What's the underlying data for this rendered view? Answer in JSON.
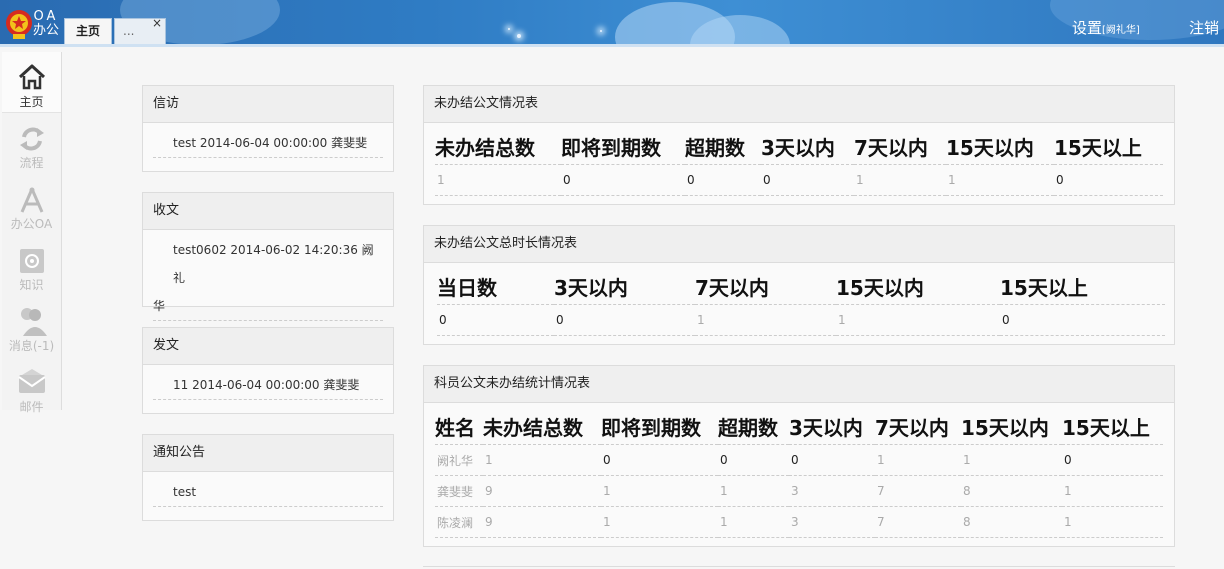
{
  "header": {
    "logo_text_1": "OA",
    "logo_text_2": "办公",
    "tabs": [
      {
        "label": "主页"
      },
      {
        "label": "...",
        "close": "×"
      }
    ],
    "settings_label": "设置",
    "settings_user": "[阙礼华]",
    "logout_label": "注销"
  },
  "nav": {
    "items": [
      {
        "label": "主页",
        "icon": "home-icon"
      },
      {
        "label": "流程",
        "icon": "flow-icon"
      },
      {
        "label": "办公OA",
        "icon": "compass-icon"
      },
      {
        "label": "知识",
        "icon": "knowledge-icon"
      },
      {
        "label": "消息(-1)",
        "icon": "message-icon"
      },
      {
        "label": "邮件",
        "icon": "mail-icon"
      }
    ]
  },
  "left_panels": {
    "xinfang": {
      "title": "信访",
      "items": [
        "test 2014-06-04 00:00:00 龚斐斐"
      ]
    },
    "shouwen": {
      "title": "收文",
      "items_line1": "test0602 2014-06-02 14:20:36 阙礼",
      "items_line2": "华"
    },
    "fawen": {
      "title": "发文",
      "items": [
        "11 2014-06-04 00:00:00 龚斐斐"
      ]
    },
    "notice": {
      "title": "通知公告",
      "items": [
        "test"
      ]
    }
  },
  "table1": {
    "title": "未办结公文情况表",
    "headers": [
      "未办结总数",
      "即将到期数",
      "超期数",
      "3天以内",
      "7天以内",
      "15天以内",
      "15天以上"
    ],
    "row": [
      "1",
      "0",
      "0",
      "0",
      "1",
      "1",
      "0"
    ]
  },
  "table2": {
    "title": "未办结公文总时长情况表",
    "headers": [
      "当日数",
      "3天以内",
      "7天以内",
      "15天以内",
      "15天以上"
    ],
    "row": [
      "0",
      "0",
      "1",
      "1",
      "0"
    ]
  },
  "table3": {
    "title": "科员公文未办结统计情况表",
    "headers": [
      "姓名",
      "未办结总数",
      "即将到期数",
      "超期数",
      "3天以内",
      "7天以内",
      "15天以内",
      "15天以上"
    ],
    "rows": [
      [
        "阙礼华",
        "1",
        "0",
        "0",
        "0",
        "1",
        "1",
        "0"
      ],
      [
        "龚斐斐",
        "9",
        "1",
        "1",
        "3",
        "7",
        "8",
        "1"
      ],
      [
        "陈凌澜",
        "9",
        "1",
        "1",
        "3",
        "7",
        "8",
        "1"
      ]
    ]
  }
}
